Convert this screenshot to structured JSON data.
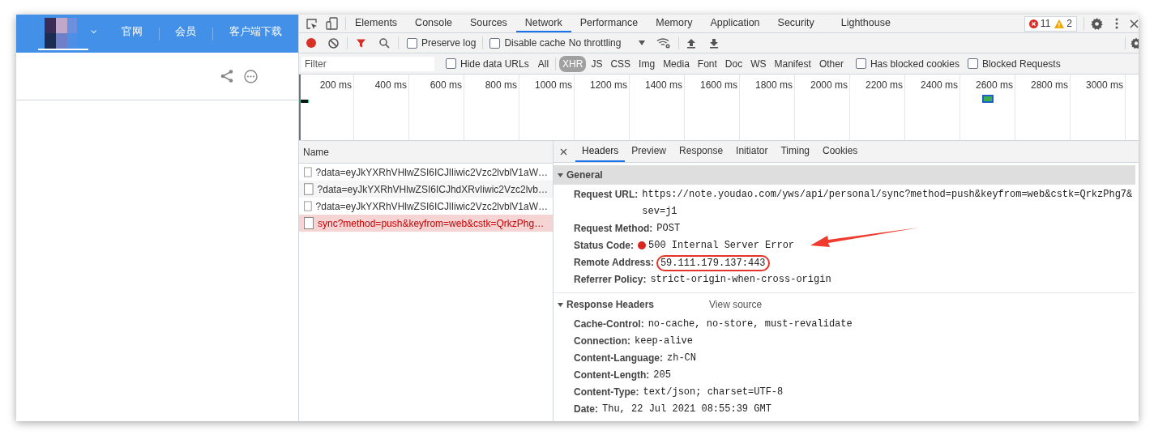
{
  "web_page": {
    "nav": [
      {
        "label": "官网"
      },
      {
        "label": "会员"
      },
      {
        "label": "客户端下载"
      }
    ]
  },
  "devtools": {
    "tabs": [
      {
        "label": "Elements",
        "selected": false
      },
      {
        "label": "Console",
        "selected": false
      },
      {
        "label": "Sources",
        "selected": false
      },
      {
        "label": "Network",
        "selected": true
      },
      {
        "label": "Performance",
        "selected": false
      },
      {
        "label": "Memory",
        "selected": false
      },
      {
        "label": "Application",
        "selected": false
      },
      {
        "label": "Security",
        "selected": false
      },
      {
        "label": "Lighthouse",
        "selected": false
      }
    ],
    "issues": {
      "errors": "11",
      "warnings": "2"
    },
    "toolbar": {
      "recording": true,
      "options": [
        {
          "label": "Preserve log",
          "checked": false
        },
        {
          "label": "Disable cache",
          "checked": false
        }
      ],
      "throttling": "No throttling"
    },
    "filter": {
      "placeholder": "Filter",
      "hide_data_urls": {
        "label": "Hide data URLs",
        "checked": false
      },
      "types": [
        {
          "label": "All",
          "selected": false
        },
        {
          "label": "XHR",
          "selected": true
        },
        {
          "label": "JS",
          "selected": false
        },
        {
          "label": "CSS",
          "selected": false
        },
        {
          "label": "Img",
          "selected": false
        },
        {
          "label": "Media",
          "selected": false
        },
        {
          "label": "Font",
          "selected": false
        },
        {
          "label": "Doc",
          "selected": false
        },
        {
          "label": "WS",
          "selected": false
        },
        {
          "label": "Manifest",
          "selected": false
        },
        {
          "label": "Other",
          "selected": false
        }
      ],
      "extra_options": [
        {
          "label": "Has blocked cookies",
          "checked": false
        },
        {
          "label": "Blocked Requests",
          "checked": false
        }
      ]
    },
    "timeline": {
      "ticks": [
        "200 ms",
        "400 ms",
        "600 ms",
        "800 ms",
        "1000 ms",
        "1200 ms",
        "1400 ms",
        "1600 ms",
        "1800 ms",
        "2000 ms",
        "2200 ms",
        "2400 ms",
        "2600 ms",
        "2800 ms",
        "3000 ms"
      ]
    },
    "requests": {
      "column": "Name",
      "rows": [
        {
          "name": "?data=eyJkYXRhVHlwZSI6ICJlIiwic2Vzc2lvblV1aW…",
          "error": false,
          "selected": false
        },
        {
          "name": "?data=eyJkYXRhVHlwZSI6ICJhdXRvIiwic2Vzc2lvb…",
          "error": false,
          "selected": false
        },
        {
          "name": "?data=eyJkYXRhVHlwZSI6ICJlIiwic2Vzc2lvblV1aW…",
          "error": false,
          "selected": false
        },
        {
          "name": "sync?method=push&keyfrom=web&cstk=QrkzPhg…",
          "error": true,
          "selected": true
        }
      ]
    },
    "details": {
      "tabs": [
        {
          "label": "Headers",
          "selected": true
        },
        {
          "label": "Preview",
          "selected": false
        },
        {
          "label": "Response",
          "selected": false
        },
        {
          "label": "Initiator",
          "selected": false
        },
        {
          "label": "Timing",
          "selected": false
        },
        {
          "label": "Cookies",
          "selected": false
        }
      ],
      "sections": [
        {
          "title": "General",
          "expanded": true,
          "rows": [
            {
              "key": "Request URL:",
              "value": "https://note.youdao.com/yws/api/personal/sync?method=push&keyfrom=web&cstk=QrkzPhg7&sev=j1"
            },
            {
              "key": "Request Method:",
              "value": "POST"
            },
            {
              "key": "Status Code:",
              "value": "500 Internal Server Error",
              "kind": "status",
              "arrow": true
            },
            {
              "key": "Remote Address:",
              "value": "59.111.179.137:443",
              "circled": true
            },
            {
              "key": "Referrer Policy:",
              "value": "strict-origin-when-cross-origin"
            }
          ]
        },
        {
          "title": "Response Headers",
          "expanded": true,
          "link": "View source",
          "rows": [
            {
              "key": "Cache-Control:",
              "value": "no-cache, no-store, must-revalidate"
            },
            {
              "key": "Connection:",
              "value": "keep-alive"
            },
            {
              "key": "Content-Language:",
              "value": "zh-CN"
            },
            {
              "key": "Content-Length:",
              "value": "205"
            },
            {
              "key": "Content-Type:",
              "value": "text/json; charset=UTF-8"
            },
            {
              "key": "Date:",
              "value": "Thu, 22 Jul 2021 08:55:39 GMT"
            }
          ]
        }
      ]
    }
  }
}
